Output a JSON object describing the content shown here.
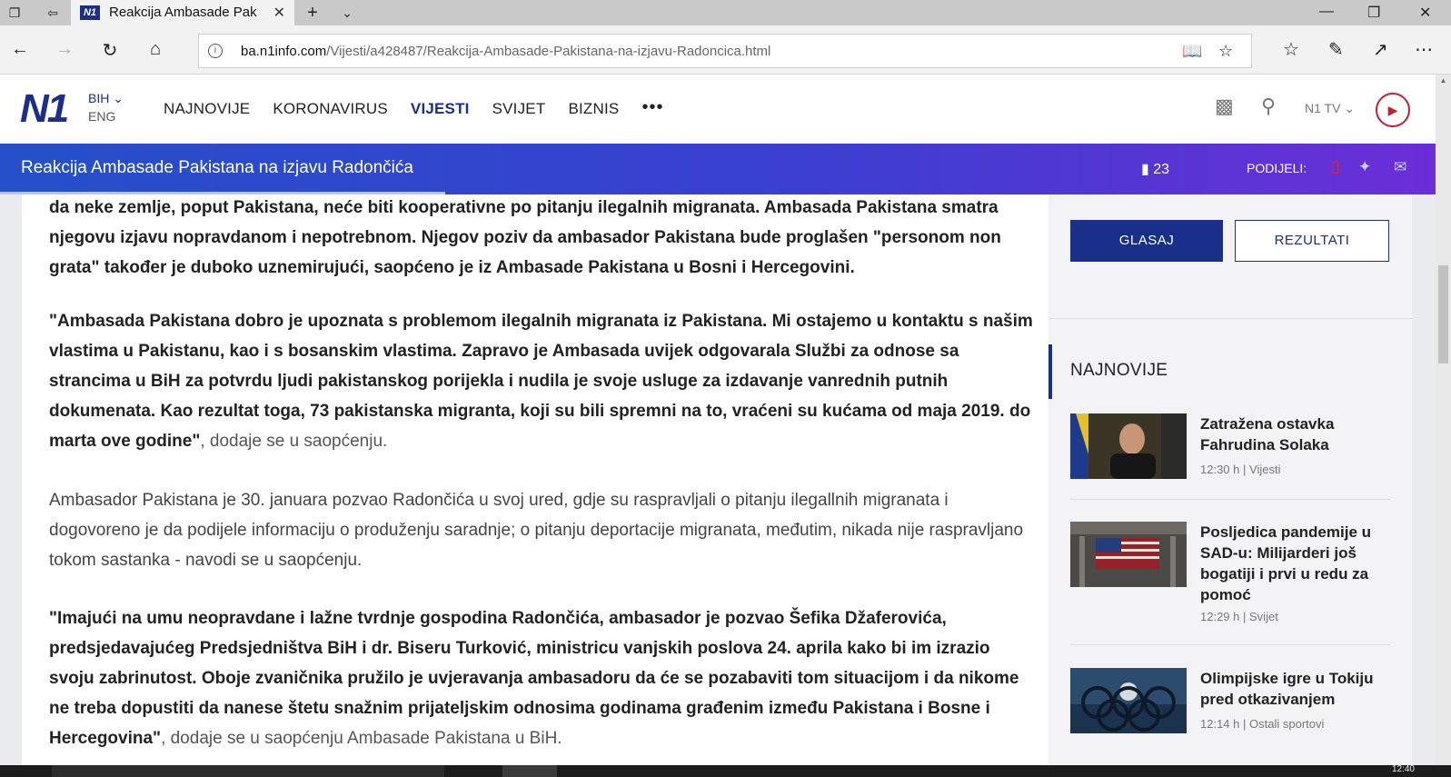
{
  "browser": {
    "tab_title": "Reakcija Ambasade Pak",
    "favicon": "N1",
    "url_host": "ba.n1info.com",
    "url_path": "/Vijesti/a428487/Reakcija-Ambasade-Pakistana-na-izjavu-Radoncica.html"
  },
  "header": {
    "logo": "N1",
    "lang_active": "BIH",
    "lang_alt": "ENG",
    "nav": [
      "NAJNOVIJE",
      "KORONAVIRUS",
      "VIJESTI",
      "SVIJET",
      "BIZNIS"
    ],
    "active_nav": "VIJESTI",
    "more": "•••",
    "tv_label": "N1 TV"
  },
  "sticky": {
    "title": "Reakcija Ambasade Pakistana na izjavu Radončića",
    "comments": "23",
    "share_label": "PODIJELI:",
    "read_progress": 0.31
  },
  "article": {
    "p1": "da neke zemlje, poput Pakistana, neće biti kooperativne po pitanju ilegalnih migranata. Ambasada Pakistana smatra njegovu izjavu nopravdanom i nepotrebnom. Njegov poziv da ambasador Pakistana bude proglašen \"personom non grata\" također je duboko uznemirujući, saopćeno je iz Ambasade Pakistana u Bosni i Hercegovini.",
    "p2_bold": "\"Ambasada Pakistana dobro je upoznata s problemom ilegalnih migranata iz Pakistana. Mi ostajemo u kontaktu s našim vlastima u Pakistanu, kao i s bosanskim vlastima. Zapravo je Ambasada uvijek odgovarala Službi za odnose sa strancima u BiH za potvrdu ljudi pakistanskog porijekla i nudila je svoje usluge za izdavanje vanrednih putnih dokumenata. Kao rezultat toga, 73 pakistanska migranta, koji su bili spremni na to, vraćeni su kućama od maja 2019. do marta ove godine\"",
    "p2_tail": ", dodaje se u saopćenju.",
    "p3": "Ambasador Pakistana je 30. januara pozvao Radončića u svoj ured, gdje su raspravljali o pitanju ilegallnih migranata i dogovoreno je da podijele informaciju o produženju saradnje; o pitanju deportacije migranata, međutim, nikada nije raspravljano tokom sastanka - navodi se u saopćenju.",
    "p4_bold": "\"Imajući na umu neopravdane i lažne tvrdnje gospodina Radončića, ambasador je pozvao Šefika Džaferovića, predsjedavajućeg Predsjedništva BiH i dr. Biseru Turković, ministricu vanjskih poslova 24. aprila kako bi im izrazio svoju zabrinutost. Oboje zvaničnika pružilo je uvjeravanja ambasadoru da će se pozabaviti tom situacijom i da nikome ne treba dopustiti da nanese štetu snažnim prijateljskim odnosima godinama građenim između Pakistana i Bosne i Hercegovina\"",
    "p4_tail": ", dodaje se u saopćenju Ambasade Pakistana u BiH."
  },
  "sidebar": {
    "vote_label": "GLASAJ",
    "results_label": "REZULTATI",
    "section_title": "NAJNOVIJE",
    "news": [
      {
        "title": "Zatražena ostavka Fahrudina Solaka",
        "time": "12:30 h",
        "category": "Vijesti"
      },
      {
        "title": "Posljedica pandemije u SAD-u: Milijarderi još bogatiji i prvi u redu za pomoć",
        "time": "12:29 h",
        "category": "Svijet"
      },
      {
        "title": "Olimpijske igre u Tokiju pred otkazivanjem",
        "time": "12:14 h",
        "category": "Ostali sportovi"
      }
    ],
    "meta_sep": "|"
  },
  "taskbar": {
    "clock": "12:40"
  },
  "colors": {
    "brand": "#1a2f8a",
    "accent_red": "#c51d34",
    "sticky_start": "#2550c9",
    "sticky_end": "#6b2ed8"
  }
}
